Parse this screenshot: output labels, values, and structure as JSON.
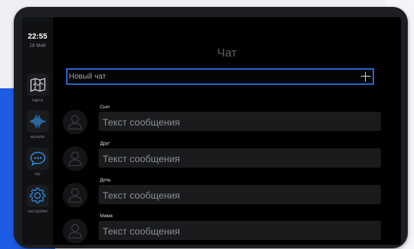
{
  "status": {
    "time": "22:55",
    "date": "18 Май"
  },
  "sidebar": {
    "items": [
      {
        "label": "карта",
        "icon": "map-icon"
      },
      {
        "label": "музыка",
        "icon": "sound-wave-icon"
      },
      {
        "label": "чат",
        "icon": "chat-icon"
      },
      {
        "label": "настройки",
        "icon": "gear-icon"
      }
    ]
  },
  "main": {
    "title": "Чат",
    "new_chat_label": "Новый чат",
    "messages": [
      {
        "sender": "Сын",
        "text": "Текст сообщения"
      },
      {
        "sender": "Друг",
        "text": "Текст сообщения"
      },
      {
        "sender": "Дочь",
        "text": "Текст сообщения"
      },
      {
        "sender": "Мама",
        "text": "Текст сообщения"
      }
    ]
  },
  "colors": {
    "accent": "#2a6edc",
    "icon_blue": "#2f8fe6",
    "background": "#000000"
  }
}
